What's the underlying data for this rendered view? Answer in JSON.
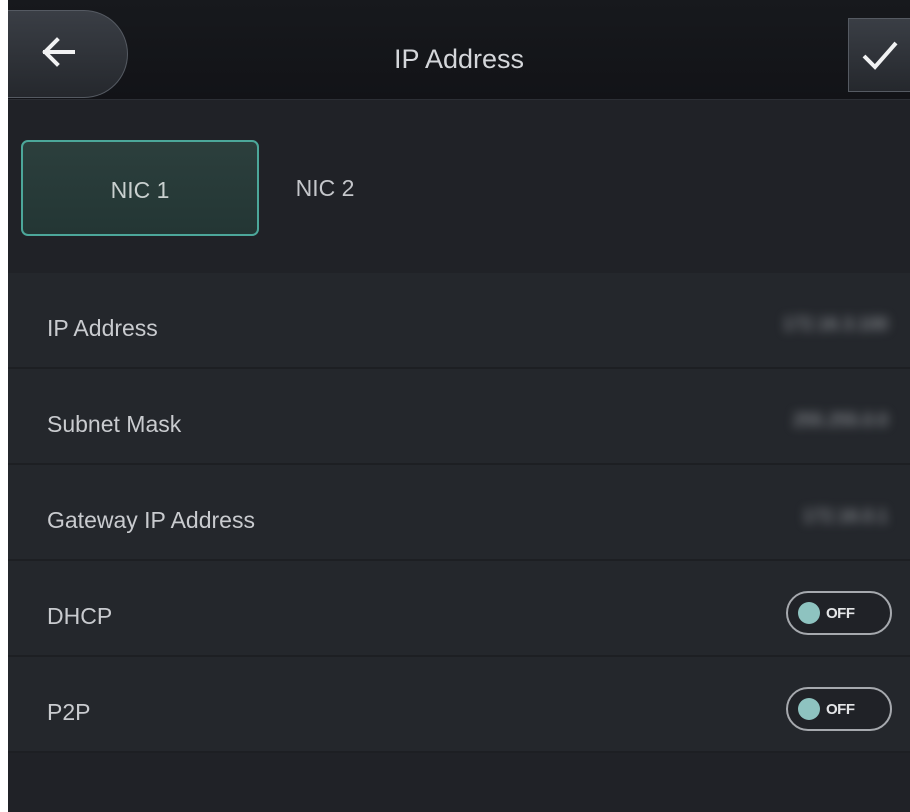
{
  "header": {
    "title": "IP Address"
  },
  "tabs": [
    {
      "label": "NIC 1",
      "selected": true
    },
    {
      "label": "NIC 2",
      "selected": false
    }
  ],
  "settings": {
    "ip_address": {
      "label": "IP Address",
      "value": "172.16.3.100"
    },
    "subnet_mask": {
      "label": "Subnet Mask",
      "value": "255.255.0.0"
    },
    "gateway": {
      "label": "Gateway IP Address",
      "value": "172.16.0.1"
    },
    "dhcp": {
      "label": "DHCP",
      "state": "OFF"
    },
    "p2p": {
      "label": "P2P",
      "state": "OFF"
    }
  },
  "colors": {
    "accent": "#4ca79a",
    "background": "#202227",
    "toggle_knob": "#8ec3c0"
  },
  "icons": {
    "back": "arrow-left-icon",
    "confirm": "checkmark-icon"
  }
}
